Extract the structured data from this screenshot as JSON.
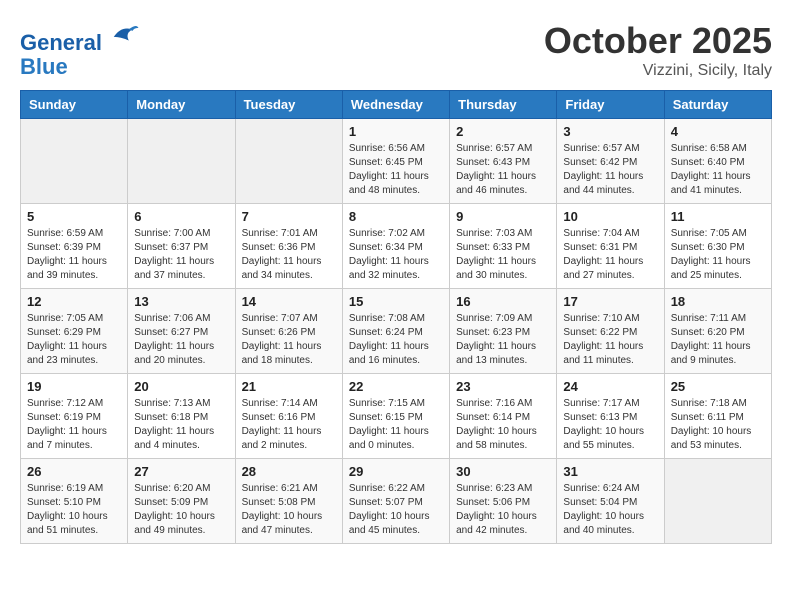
{
  "header": {
    "logo_line1": "General",
    "logo_line2": "Blue",
    "month": "October 2025",
    "location": "Vizzini, Sicily, Italy"
  },
  "weekdays": [
    "Sunday",
    "Monday",
    "Tuesday",
    "Wednesday",
    "Thursday",
    "Friday",
    "Saturday"
  ],
  "weeks": [
    [
      {
        "day": "",
        "info": ""
      },
      {
        "day": "",
        "info": ""
      },
      {
        "day": "",
        "info": ""
      },
      {
        "day": "1",
        "info": "Sunrise: 6:56 AM\nSunset: 6:45 PM\nDaylight: 11 hours and 48 minutes."
      },
      {
        "day": "2",
        "info": "Sunrise: 6:57 AM\nSunset: 6:43 PM\nDaylight: 11 hours and 46 minutes."
      },
      {
        "day": "3",
        "info": "Sunrise: 6:57 AM\nSunset: 6:42 PM\nDaylight: 11 hours and 44 minutes."
      },
      {
        "day": "4",
        "info": "Sunrise: 6:58 AM\nSunset: 6:40 PM\nDaylight: 11 hours and 41 minutes."
      }
    ],
    [
      {
        "day": "5",
        "info": "Sunrise: 6:59 AM\nSunset: 6:39 PM\nDaylight: 11 hours and 39 minutes."
      },
      {
        "day": "6",
        "info": "Sunrise: 7:00 AM\nSunset: 6:37 PM\nDaylight: 11 hours and 37 minutes."
      },
      {
        "day": "7",
        "info": "Sunrise: 7:01 AM\nSunset: 6:36 PM\nDaylight: 11 hours and 34 minutes."
      },
      {
        "day": "8",
        "info": "Sunrise: 7:02 AM\nSunset: 6:34 PM\nDaylight: 11 hours and 32 minutes."
      },
      {
        "day": "9",
        "info": "Sunrise: 7:03 AM\nSunset: 6:33 PM\nDaylight: 11 hours and 30 minutes."
      },
      {
        "day": "10",
        "info": "Sunrise: 7:04 AM\nSunset: 6:31 PM\nDaylight: 11 hours and 27 minutes."
      },
      {
        "day": "11",
        "info": "Sunrise: 7:05 AM\nSunset: 6:30 PM\nDaylight: 11 hours and 25 minutes."
      }
    ],
    [
      {
        "day": "12",
        "info": "Sunrise: 7:05 AM\nSunset: 6:29 PM\nDaylight: 11 hours and 23 minutes."
      },
      {
        "day": "13",
        "info": "Sunrise: 7:06 AM\nSunset: 6:27 PM\nDaylight: 11 hours and 20 minutes."
      },
      {
        "day": "14",
        "info": "Sunrise: 7:07 AM\nSunset: 6:26 PM\nDaylight: 11 hours and 18 minutes."
      },
      {
        "day": "15",
        "info": "Sunrise: 7:08 AM\nSunset: 6:24 PM\nDaylight: 11 hours and 16 minutes."
      },
      {
        "day": "16",
        "info": "Sunrise: 7:09 AM\nSunset: 6:23 PM\nDaylight: 11 hours and 13 minutes."
      },
      {
        "day": "17",
        "info": "Sunrise: 7:10 AM\nSunset: 6:22 PM\nDaylight: 11 hours and 11 minutes."
      },
      {
        "day": "18",
        "info": "Sunrise: 7:11 AM\nSunset: 6:20 PM\nDaylight: 11 hours and 9 minutes."
      }
    ],
    [
      {
        "day": "19",
        "info": "Sunrise: 7:12 AM\nSunset: 6:19 PM\nDaylight: 11 hours and 7 minutes."
      },
      {
        "day": "20",
        "info": "Sunrise: 7:13 AM\nSunset: 6:18 PM\nDaylight: 11 hours and 4 minutes."
      },
      {
        "day": "21",
        "info": "Sunrise: 7:14 AM\nSunset: 6:16 PM\nDaylight: 11 hours and 2 minutes."
      },
      {
        "day": "22",
        "info": "Sunrise: 7:15 AM\nSunset: 6:15 PM\nDaylight: 11 hours and 0 minutes."
      },
      {
        "day": "23",
        "info": "Sunrise: 7:16 AM\nSunset: 6:14 PM\nDaylight: 10 hours and 58 minutes."
      },
      {
        "day": "24",
        "info": "Sunrise: 7:17 AM\nSunset: 6:13 PM\nDaylight: 10 hours and 55 minutes."
      },
      {
        "day": "25",
        "info": "Sunrise: 7:18 AM\nSunset: 6:11 PM\nDaylight: 10 hours and 53 minutes."
      }
    ],
    [
      {
        "day": "26",
        "info": "Sunrise: 6:19 AM\nSunset: 5:10 PM\nDaylight: 10 hours and 51 minutes."
      },
      {
        "day": "27",
        "info": "Sunrise: 6:20 AM\nSunset: 5:09 PM\nDaylight: 10 hours and 49 minutes."
      },
      {
        "day": "28",
        "info": "Sunrise: 6:21 AM\nSunset: 5:08 PM\nDaylight: 10 hours and 47 minutes."
      },
      {
        "day": "29",
        "info": "Sunrise: 6:22 AM\nSunset: 5:07 PM\nDaylight: 10 hours and 45 minutes."
      },
      {
        "day": "30",
        "info": "Sunrise: 6:23 AM\nSunset: 5:06 PM\nDaylight: 10 hours and 42 minutes."
      },
      {
        "day": "31",
        "info": "Sunrise: 6:24 AM\nSunset: 5:04 PM\nDaylight: 10 hours and 40 minutes."
      },
      {
        "day": "",
        "info": ""
      }
    ]
  ]
}
